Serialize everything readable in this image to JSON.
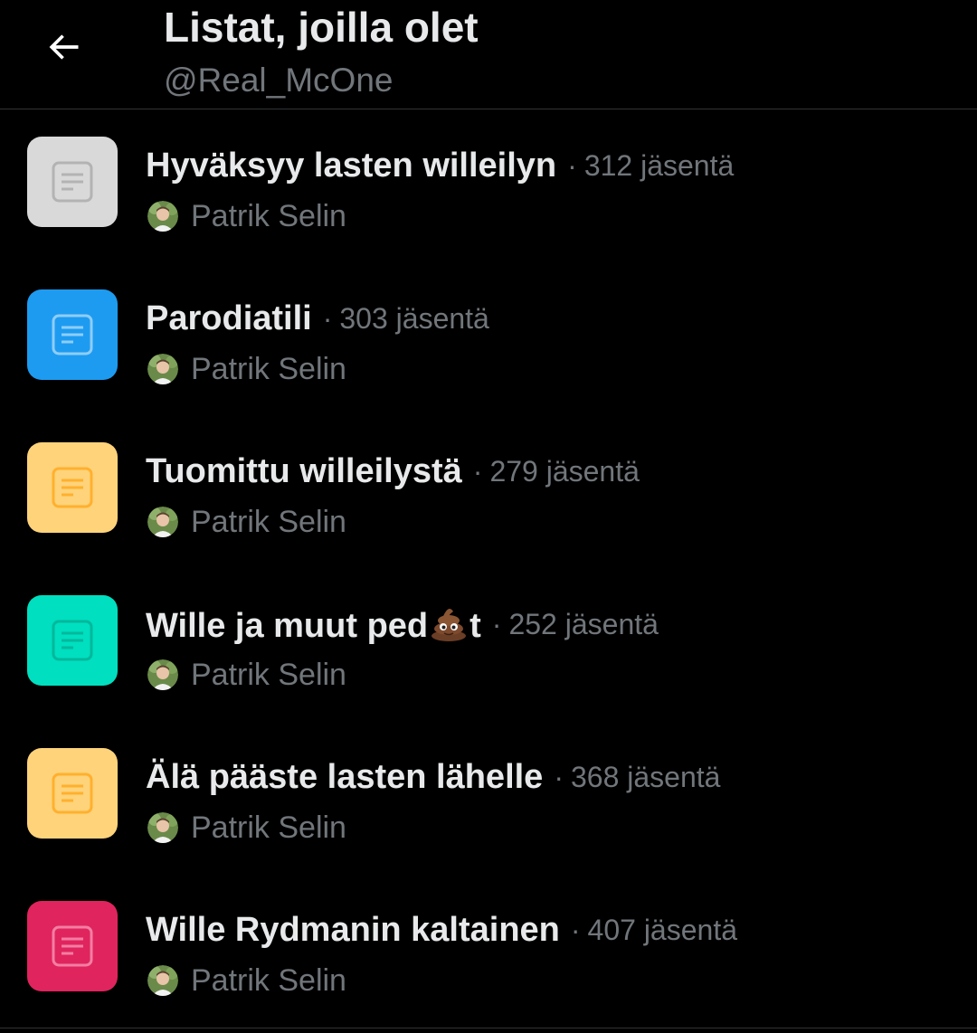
{
  "header": {
    "back_icon": "arrow-left-icon",
    "title": "Listat, joilla olet",
    "handle": "@Real_McOne"
  },
  "separator": "·",
  "lists": [
    {
      "name": "Hyväksyy lasten willeilyn",
      "members": "312 jäsentä",
      "owner": "Patrik Selin",
      "icon_color": "#d9d9d9",
      "icon_glyph_color": "#b3b3b3"
    },
    {
      "name": "Parodiatili",
      "members": "303 jäsentä",
      "owner": "Patrik Selin",
      "icon_color": "#1d9bf0",
      "icon_glyph_color": "#8ecdf8"
    },
    {
      "name": "Tuomittu willeilystä",
      "members": "279 jäsentä",
      "owner": "Patrik Selin",
      "icon_color": "#ffd37a",
      "icon_glyph_color": "#ffb02e"
    },
    {
      "name_part1": "Wille ja muut ped",
      "name_emoji": "pile-of-poo-emoji",
      "name_part2": "t",
      "members": "252 jäsentä",
      "owner": "Patrik Selin",
      "icon_color": "#00dfbf",
      "icon_glyph_color": "#00b89c"
    },
    {
      "name": "Älä pääste lasten lähelle",
      "members": "368 jäsentä",
      "owner": "Patrik Selin",
      "icon_color": "#ffd37a",
      "icon_glyph_color": "#ffb02e"
    },
    {
      "name": "Wille Rydmanin kaltainen",
      "members": "407 jäsentä",
      "owner": "Patrik Selin",
      "icon_color": "#e0245e",
      "icon_glyph_color": "#f27ea3"
    }
  ]
}
